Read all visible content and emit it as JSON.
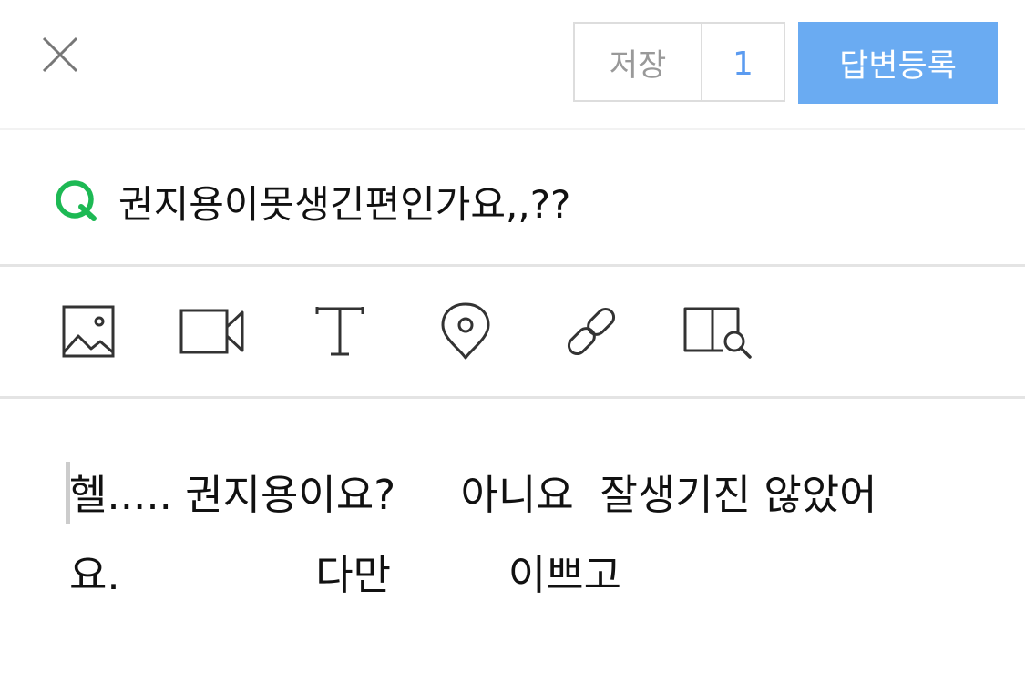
{
  "header": {
    "close_icon": "close-icon",
    "save_label": "저장",
    "save_count": "1",
    "submit_label": "답변등록",
    "submit_color": "#6aabf2",
    "count_color": "#5b9bf0"
  },
  "question": {
    "marker_icon": "q-mark-icon",
    "marker_color": "#1db954",
    "title": "권지용이못생긴편인가요,,??"
  },
  "toolbar": {
    "tools": [
      {
        "icon": "image-icon"
      },
      {
        "icon": "video-icon"
      },
      {
        "icon": "text-icon"
      },
      {
        "icon": "location-pin-icon"
      },
      {
        "icon": "link-icon"
      },
      {
        "icon": "book-search-icon"
      }
    ]
  },
  "editor": {
    "lines": [
      "헬..... 권지용이요?     아니요  잘생기진 않았어",
      "요.               다만         이쁘고"
    ]
  }
}
